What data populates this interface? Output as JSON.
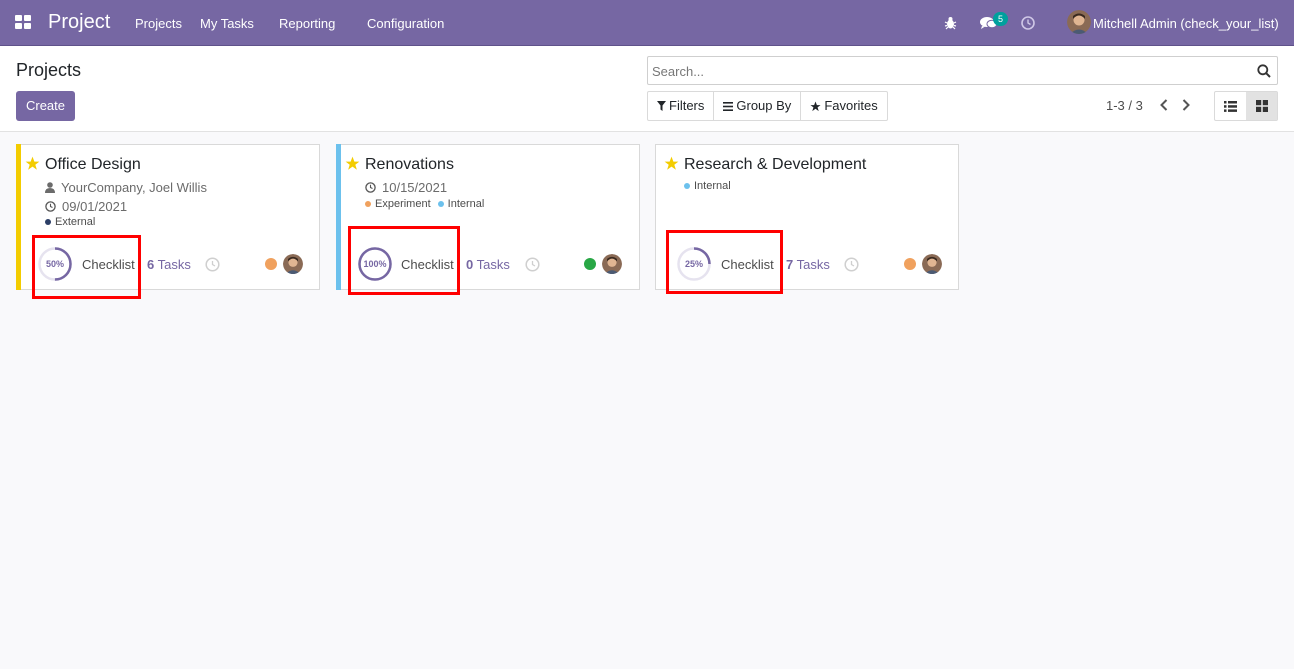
{
  "navbar": {
    "app_name": "Project",
    "menu": [
      "Projects",
      "My Tasks",
      "Reporting",
      "Configuration"
    ],
    "messages_count": "5",
    "user": "Mitchell Admin (check_your_list)"
  },
  "control": {
    "title": "Projects",
    "create": "Create",
    "search_placeholder": "Search...",
    "filters": "Filters",
    "group_by": "Group By",
    "favorites": "Favorites",
    "pager": "1-3 / 3"
  },
  "colors": {
    "accent": "#7667a3",
    "star": "#f3cc00",
    "highlight": "#ff0000"
  },
  "projects": [
    {
      "name": "Office Design",
      "customer": "YourCompany, Joel Willis",
      "date": "09/01/2021",
      "tags": [
        {
          "label": "External",
          "color": "#2c3e66"
        }
      ],
      "progress": "50%",
      "progress_value": 50,
      "checklist": "Checklist",
      "task_count": "6",
      "tasks_label": "Tasks",
      "status_color": "#f0a15e",
      "stripe_color": "#f3cc00"
    },
    {
      "name": "Renovations",
      "date": "10/15/2021",
      "tags": [
        {
          "label": "Experiment",
          "color": "#f0a15e"
        },
        {
          "label": "Internal",
          "color": "#6cc1ed"
        }
      ],
      "progress": "100%",
      "progress_value": 100,
      "checklist": "Checklist",
      "task_count": "0",
      "tasks_label": "Tasks",
      "status_color": "#28a745",
      "stripe_color": "#6cc1ed"
    },
    {
      "name": "Research & Development",
      "tags": [
        {
          "label": "Internal",
          "color": "#6cc1ed"
        }
      ],
      "progress": "25%",
      "progress_value": 25,
      "checklist": "Checklist",
      "task_count": "7",
      "tasks_label": "Tasks",
      "status_color": "#f0a15e"
    }
  ]
}
